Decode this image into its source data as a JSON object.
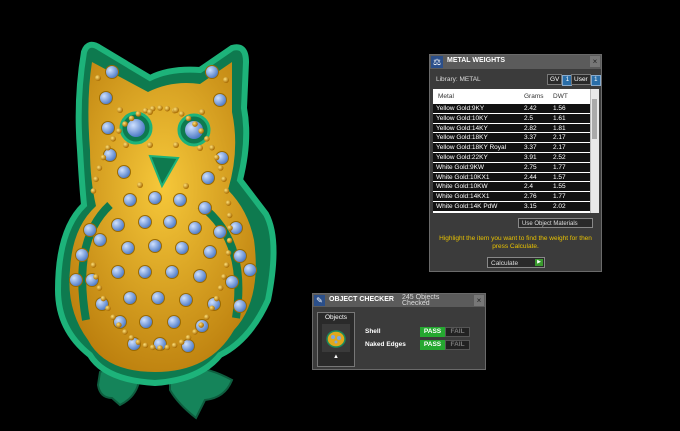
{
  "metal_weights": {
    "title": "METAL WEIGHTS",
    "close": "×",
    "library_label": "Library: METAL",
    "gv_label": "GV",
    "gv_value": "1",
    "user_label": "User",
    "user_value": "1",
    "columns": {
      "metal": "Metal",
      "grams": "Grams",
      "dwt": "DWT"
    },
    "rows": [
      {
        "metal": "Yellow Gold:9KY",
        "grams": "2.42",
        "dwt": "1.56"
      },
      {
        "metal": "Yellow Gold:10KY",
        "grams": "2.5",
        "dwt": "1.61"
      },
      {
        "metal": "Yellow Gold:14KY",
        "grams": "2.82",
        "dwt": "1.81"
      },
      {
        "metal": "Yellow Gold:18KY",
        "grams": "3.37",
        "dwt": "2.17"
      },
      {
        "metal": "Yellow Gold:18KY Royal",
        "grams": "3.37",
        "dwt": "2.17"
      },
      {
        "metal": "Yellow Gold:22KY",
        "grams": "3.91",
        "dwt": "2.52"
      },
      {
        "metal": "White Gold:9KW",
        "grams": "2.75",
        "dwt": "1.77"
      },
      {
        "metal": "White Gold:10KX1",
        "grams": "2.44",
        "dwt": "1.57"
      },
      {
        "metal": "White Gold:10KW",
        "grams": "2.4",
        "dwt": "1.55"
      },
      {
        "metal": "White Gold:14KX1",
        "grams": "2.76",
        "dwt": "1.77"
      },
      {
        "metal": "White Gold:14K PdW",
        "grams": "3.15",
        "dwt": "2.02"
      }
    ],
    "use_object_materials": "Use Object Materials",
    "hint": "Highlight the item you want to find the weight for then press Calculate.",
    "calculate": "Calculate"
  },
  "object_checker": {
    "title": "OBJECT CHECKER",
    "count": "245 Objects Checked",
    "close": "×",
    "objects_label": "Objects",
    "checks": [
      {
        "name": "Shell",
        "pass": "PASS",
        "fail": "FAIL"
      },
      {
        "name": "Naked Edges",
        "pass": "PASS",
        "fail": "FAIL"
      }
    ]
  },
  "colors": {
    "gold": "#e0a81c",
    "green": "#1a8a5c",
    "gem": "#7ea9e0",
    "pass": "#25a830",
    "hint": "#e8c200"
  }
}
